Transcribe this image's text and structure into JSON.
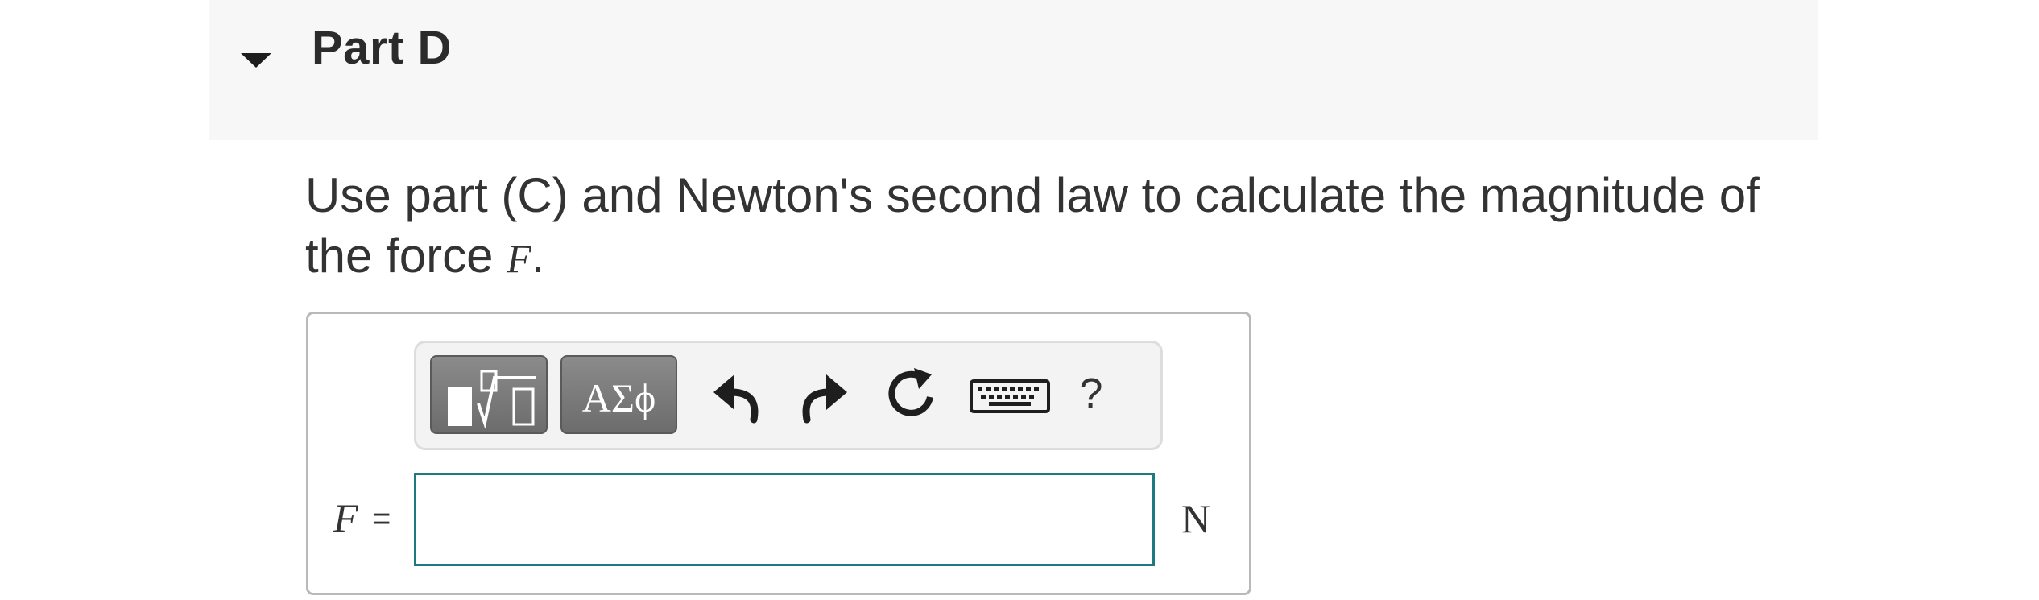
{
  "part": {
    "title": "Part D",
    "toggle_icon": "caret-down-icon"
  },
  "question": {
    "text_before": "Use part (C) and Newton's second law to calculate the magnitude of the force ",
    "variable": "F",
    "text_after": "."
  },
  "toolbar": {
    "templates_icon": "templates-icon",
    "greek_label": "ΑΣϕ",
    "undo_icon": "undo-icon",
    "redo_icon": "redo-icon",
    "reset_icon": "reset-icon",
    "keyboard_icon": "keyboard-icon",
    "help_label": "?"
  },
  "answer": {
    "variable": "F",
    "equals": "=",
    "value": "",
    "placeholder": "",
    "unit": "N"
  },
  "colors": {
    "header_bg": "#f7f7f7",
    "input_border": "#1e7a80",
    "toolbar_button_bg": "#7c7c7c"
  }
}
